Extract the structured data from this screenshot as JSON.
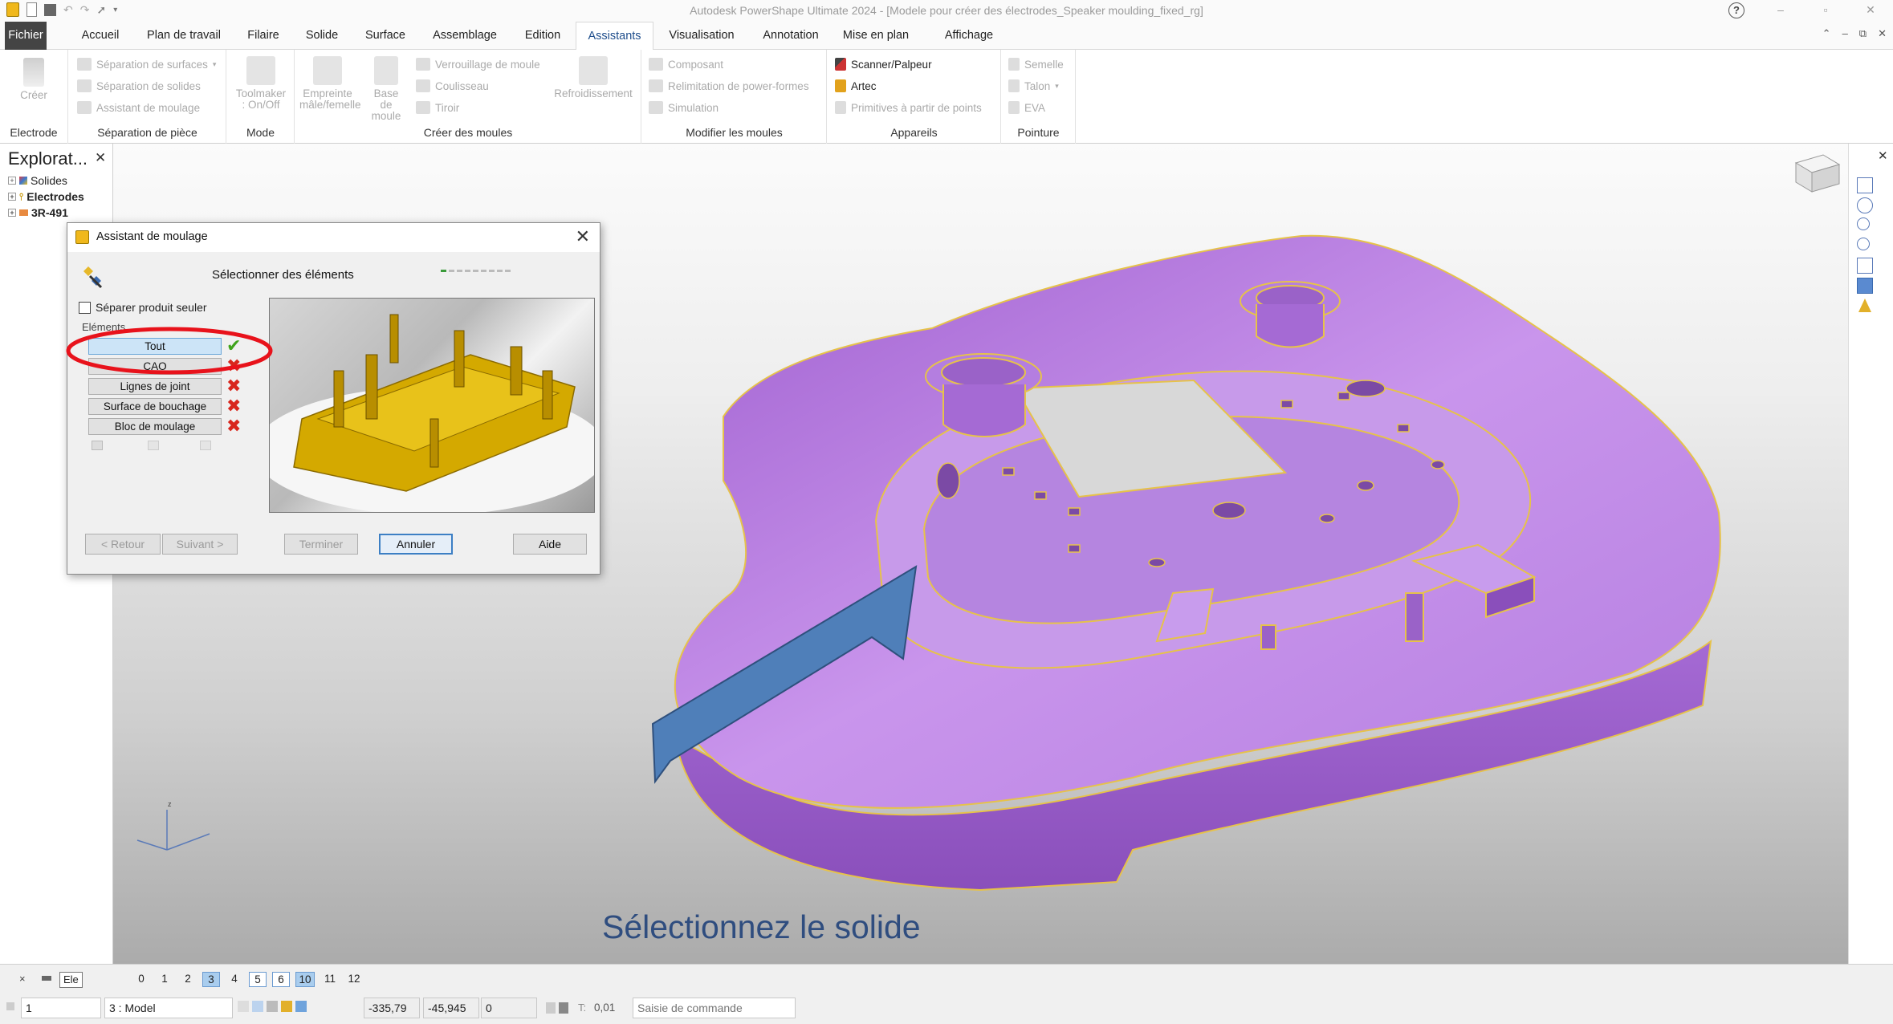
{
  "window": {
    "title": "Autodesk PowerShape Ultimate 2024 - [Modele pour créer des électrodes_Speaker moulding_fixed_rg]",
    "help_glyph": "?",
    "minimize_glyph": "–",
    "restore_glyph": "▫",
    "close_glyph": "✕"
  },
  "tabs": [
    "Fichier",
    "Accueil",
    "Plan de travail",
    "Filaire",
    "Solide",
    "Surface",
    "Assemblage",
    "Edition",
    "Assistants",
    "Visualisation",
    "Annotation",
    "Mise en plan",
    "Affichage"
  ],
  "active_tab": "Assistants",
  "ribbon_controls": {
    "up": "⌃",
    "min": "–",
    "restore": "⧉",
    "close": "✕"
  },
  "ribbon": {
    "electrode": {
      "label": "Electrode",
      "creer": "Créer"
    },
    "separation": {
      "label": "Séparation de pièce",
      "items": [
        "Séparation de surfaces",
        "Séparation de solides",
        "Assistant de moulage"
      ]
    },
    "mode": {
      "label": "Mode",
      "toolmaker_line1": "Toolmaker",
      "toolmaker_line2": ": On/Off"
    },
    "creer_moules": {
      "label": "Créer des moules",
      "empreinte_line1": "Empreinte",
      "empreinte_line2": "mâle/femelle",
      "base_line1": "Base de",
      "base_line2": "moule",
      "items": [
        "Verrouillage de moule",
        "Coulisseau",
        "Tiroir"
      ],
      "refroidissement": "Refroidissement"
    },
    "modifier_moules": {
      "label": "Modifier les moules",
      "items": [
        "Composant",
        "Relimitation de power-formes",
        "Simulation"
      ]
    },
    "appareils": {
      "label": "Appareils",
      "items": [
        "Scanner/Palpeur",
        "Artec",
        "Primitives à partir de points"
      ]
    },
    "pointure": {
      "label": "Pointure",
      "items": [
        "Semelle",
        "Talon",
        "EVA"
      ]
    }
  },
  "explorer": {
    "title": "Explorat...",
    "close_glyph": "✕",
    "items": [
      "Solides",
      "Electrodes",
      "3R-491"
    ]
  },
  "dialog": {
    "title": "Assistant de moulage",
    "close_glyph": "✕",
    "heading": "Sélectionner des éléments",
    "separate_checkbox": "Séparer produit seuler",
    "elements_label": "Eléments",
    "element_buttons": [
      "Tout",
      "CAO",
      "Lignes de joint",
      "Surface de bouchage",
      "Bloc de moulage"
    ],
    "element_status": [
      "ok",
      "error",
      "error",
      "error",
      "error"
    ],
    "ok_glyph": "✔",
    "error_glyph": "✖",
    "buttons": {
      "back": "< Retour",
      "next": "Suivant >",
      "finish": "Terminer",
      "cancel": "Annuler",
      "help": "Aide"
    }
  },
  "annotation": {
    "text": "Sélectionnez le solide",
    "circle_color": "#e8121b",
    "arrow_color": "#4f7fb9"
  },
  "viewport": {
    "model_color": "#b77ce0",
    "edge_color": "#e6c24a"
  },
  "levels": {
    "close_glyph": "×",
    "ele_label": "Ele",
    "numbers": [
      "0",
      "1",
      "2",
      "3",
      "4",
      "5",
      "6",
      "10",
      "11",
      "12"
    ],
    "selected": [
      "3",
      "10"
    ],
    "outlined": [
      "5",
      "6"
    ]
  },
  "statusbar": {
    "workplane_value": "1",
    "model_value": "3   : Model",
    "x_coord": "-335,79",
    "y_coord": "-45,945",
    "z_coord": "0",
    "tolerance_label": "T:",
    "tolerance_value": "0,01",
    "command_placeholder": "Saisie de commande"
  }
}
